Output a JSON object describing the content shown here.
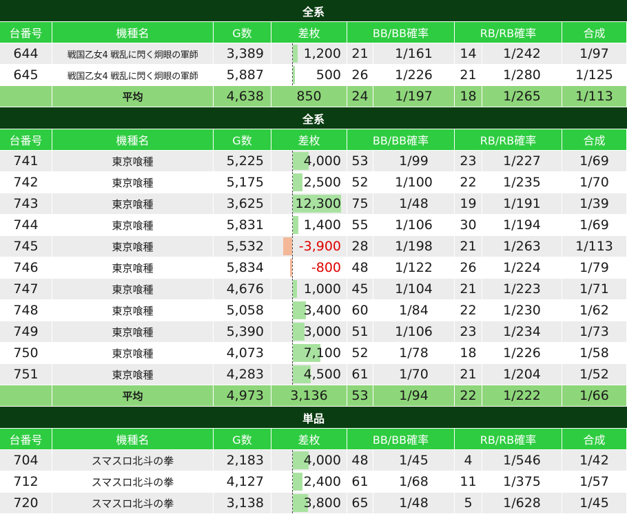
{
  "colors": {
    "title_bg": "#0b3d12",
    "header_bg": "#2ecc40",
    "avg_bg": "#8ed67a",
    "pos_bar": "#a9e2a0",
    "neg_bar": "#f4b898",
    "neg_text": "#e00000"
  },
  "headers": {
    "id": "台番号",
    "name": "機種名",
    "g": "G数",
    "diff": "差枚",
    "bb": "BB/BB確率",
    "rb": "RB/RB確率",
    "total": "合成"
  },
  "sections": [
    {
      "title": "全系",
      "rows": [
        {
          "id": "644",
          "name": "戦国乙女4 戦乱に閃く炯眼の軍師",
          "g": "3,389",
          "diff": "1,200",
          "diff_value": 1200,
          "bb": "21",
          "bb_rate": "1/161",
          "rb": "14",
          "rb_rate": "1/242",
          "total": "1/97"
        },
        {
          "id": "645",
          "name": "戦国乙女4 戦乱に閃く炯眼の軍師",
          "g": "5,887",
          "diff": "500",
          "diff_value": 500,
          "bb": "26",
          "bb_rate": "1/226",
          "rb": "21",
          "rb_rate": "1/280",
          "total": "1/125"
        }
      ],
      "avg": {
        "label": "平均",
        "g": "4,638",
        "diff": "850",
        "bb": "24",
        "bb_rate": "1/197",
        "rb": "18",
        "rb_rate": "1/265",
        "total": "1/113"
      }
    },
    {
      "title": "全系",
      "rows": [
        {
          "id": "741",
          "name": "東京喰種",
          "g": "5,225",
          "diff": "4,000",
          "diff_value": 4000,
          "bb": "53",
          "bb_rate": "1/99",
          "rb": "23",
          "rb_rate": "1/227",
          "total": "1/69"
        },
        {
          "id": "742",
          "name": "東京喰種",
          "g": "5,175",
          "diff": "2,500",
          "diff_value": 2500,
          "bb": "52",
          "bb_rate": "1/100",
          "rb": "22",
          "rb_rate": "1/235",
          "total": "1/70"
        },
        {
          "id": "743",
          "name": "東京喰種",
          "g": "3,625",
          "diff": "12,300",
          "diff_value": 12300,
          "bb": "75",
          "bb_rate": "1/48",
          "rb": "19",
          "rb_rate": "1/191",
          "total": "1/39"
        },
        {
          "id": "744",
          "name": "東京喰種",
          "g": "5,831",
          "diff": "1,400",
          "diff_value": 1400,
          "bb": "55",
          "bb_rate": "1/106",
          "rb": "30",
          "rb_rate": "1/194",
          "total": "1/69"
        },
        {
          "id": "745",
          "name": "東京喰種",
          "g": "5,532",
          "diff": "-3,900",
          "diff_value": -3900,
          "bb": "28",
          "bb_rate": "1/198",
          "rb": "21",
          "rb_rate": "1/263",
          "total": "1/113"
        },
        {
          "id": "746",
          "name": "東京喰種",
          "g": "5,834",
          "diff": "-800",
          "diff_value": -800,
          "bb": "48",
          "bb_rate": "1/122",
          "rb": "26",
          "rb_rate": "1/224",
          "total": "1/79"
        },
        {
          "id": "747",
          "name": "東京喰種",
          "g": "4,676",
          "diff": "1,000",
          "diff_value": 1000,
          "bb": "45",
          "bb_rate": "1/104",
          "rb": "21",
          "rb_rate": "1/223",
          "total": "1/71"
        },
        {
          "id": "748",
          "name": "東京喰種",
          "g": "5,058",
          "diff": "3,400",
          "diff_value": 3400,
          "bb": "60",
          "bb_rate": "1/84",
          "rb": "22",
          "rb_rate": "1/230",
          "total": "1/62"
        },
        {
          "id": "749",
          "name": "東京喰種",
          "g": "5,390",
          "diff": "3,000",
          "diff_value": 3000,
          "bb": "51",
          "bb_rate": "1/106",
          "rb": "23",
          "rb_rate": "1/234",
          "total": "1/73"
        },
        {
          "id": "750",
          "name": "東京喰種",
          "g": "4,073",
          "diff": "7,100",
          "diff_value": 7100,
          "bb": "52",
          "bb_rate": "1/78",
          "rb": "18",
          "rb_rate": "1/226",
          "total": "1/58"
        },
        {
          "id": "751",
          "name": "東京喰種",
          "g": "4,283",
          "diff": "4,500",
          "diff_value": 4500,
          "bb": "61",
          "bb_rate": "1/70",
          "rb": "21",
          "rb_rate": "1/204",
          "total": "1/52"
        }
      ],
      "avg": {
        "label": "平均",
        "g": "4,973",
        "diff": "3,136",
        "bb": "53",
        "bb_rate": "1/94",
        "rb": "22",
        "rb_rate": "1/222",
        "total": "1/66"
      }
    },
    {
      "title": "単品",
      "rows": [
        {
          "id": "704",
          "name": "スマスロ北斗の拳",
          "g": "2,183",
          "diff": "4,000",
          "diff_value": 4000,
          "bb": "48",
          "bb_rate": "1/45",
          "rb": "4",
          "rb_rate": "1/546",
          "total": "1/42"
        },
        {
          "id": "712",
          "name": "スマスロ北斗の拳",
          "g": "4,127",
          "diff": "2,400",
          "diff_value": 2400,
          "bb": "61",
          "bb_rate": "1/68",
          "rb": "11",
          "rb_rate": "1/375",
          "total": "1/57"
        },
        {
          "id": "720",
          "name": "スマスロ北斗の拳",
          "g": "3,138",
          "diff": "3,800",
          "diff_value": 3800,
          "bb": "65",
          "bb_rate": "1/48",
          "rb": "5",
          "rb_rate": "1/628",
          "total": "1/45"
        }
      ]
    }
  ]
}
